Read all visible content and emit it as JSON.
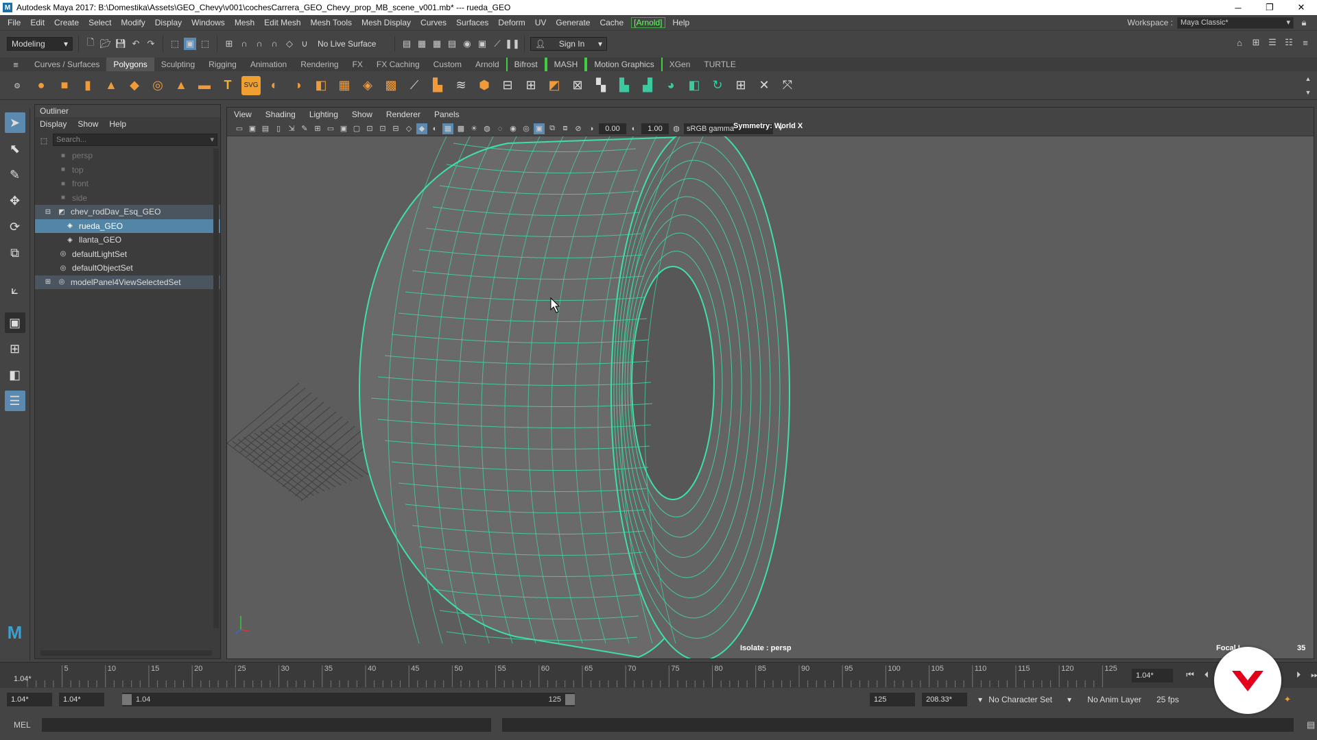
{
  "titlebar": {
    "title": "Autodesk Maya 2017: B:\\Domestika\\Assets\\GEO_Chevy\\v001\\cochesCarrera_GEO_Chevy_prop_MB_scene_v001.mb*  ---  rueda_GEO",
    "minimize": "─",
    "restore": "❐",
    "close": "✕"
  },
  "menubar": {
    "items": [
      "File",
      "Edit",
      "Create",
      "Select",
      "Modify",
      "Display",
      "Windows",
      "Mesh",
      "Edit Mesh",
      "Mesh Tools",
      "Mesh Display",
      "Curves",
      "Surfaces",
      "Deform",
      "UV",
      "Generate",
      "Cache",
      "[Arnold]",
      "Help"
    ],
    "workspace_label": "Workspace :",
    "workspace_value": "Maya Classic*"
  },
  "statusline": {
    "mode": "Modeling",
    "live_surface": "No Live Surface",
    "sign_in": "Sign In"
  },
  "shelf_tabs": [
    "Curves / Surfaces",
    "Polygons",
    "Sculpting",
    "Rigging",
    "Animation",
    "Rendering",
    "FX",
    "FX Caching",
    "Custom",
    "Arnold",
    "Bifrost",
    "MASH",
    "Motion Graphics",
    "XGen",
    "TURTLE"
  ],
  "outliner": {
    "title": "Outliner",
    "menu": [
      "Display",
      "Show",
      "Help"
    ],
    "search_placeholder": "Search...",
    "items": [
      {
        "label": "persp",
        "dim": true
      },
      {
        "label": "top",
        "dim": true
      },
      {
        "label": "front",
        "dim": true
      },
      {
        "label": "side",
        "dim": true
      },
      {
        "label": "chev_rodDav_Esq_GEO"
      },
      {
        "label": "rueda_GEO"
      },
      {
        "label": "llanta_GEO"
      },
      {
        "label": "defaultLightSet"
      },
      {
        "label": "defaultObjectSet"
      },
      {
        "label": "modelPanel4ViewSelectedSet"
      }
    ]
  },
  "viewport": {
    "menu": [
      "View",
      "Shading",
      "Lighting",
      "Show",
      "Renderer",
      "Panels"
    ],
    "exposure": "0.00",
    "gamma": "1.00",
    "colorspace": "sRGB gamma",
    "symmetry": "Symmetry: World X",
    "isolate": "Isolate : persp",
    "focal_label": "Focal L",
    "focal_value": "35",
    "wire_color": "#3fe0a6"
  },
  "timeline": {
    "ticks": [
      "5",
      "10",
      "15",
      "20",
      "25",
      "30",
      "35",
      "40",
      "45",
      "50",
      "55",
      "60",
      "65",
      "70",
      "75",
      "80",
      "85",
      "90",
      "95",
      "100",
      "105",
      "110",
      "115",
      "120",
      "125"
    ],
    "start_marker": "1.04*",
    "current": "1.04*"
  },
  "range": {
    "start": "1.04*",
    "anim_start": "1.04*",
    "slider_start": "1.04",
    "slider_end": "125",
    "anim_end": "125",
    "end": "208.33*",
    "character_set": "No Character Set",
    "anim_layer": "No Anim Layer",
    "fps": "25 fps"
  },
  "cmdline": {
    "label": "MEL"
  }
}
